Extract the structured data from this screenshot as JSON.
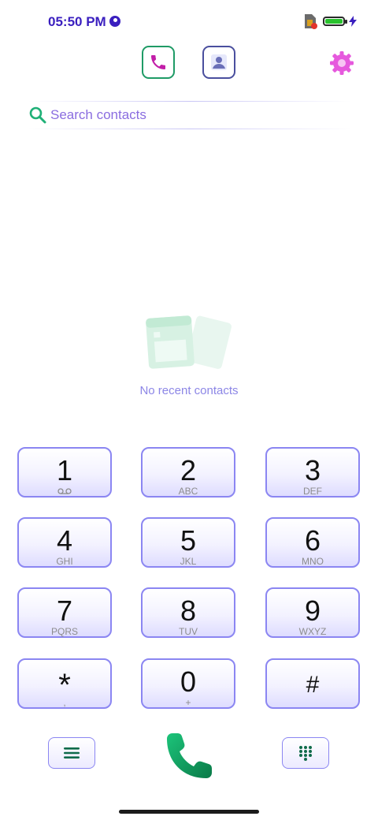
{
  "status_bar": {
    "time": "05:50 PM",
    "battery_level": 1.0,
    "battery_color": "#29c22d"
  },
  "tabs": [
    {
      "name": "phone",
      "icon": "phone-icon",
      "active": true,
      "color": "#1f9b66"
    },
    {
      "name": "contacts",
      "icon": "person-icon",
      "active": false,
      "color": "#4a4f9e"
    }
  ],
  "settings_icon": "gear-icon",
  "search": {
    "placeholder": "Search contacts",
    "value": ""
  },
  "empty_state": {
    "icon": "recent-contacts-illustration",
    "message": "No recent contacts"
  },
  "dialpad": {
    "keys": [
      {
        "digit": "1",
        "letters": "",
        "icon": "voicemail-icon"
      },
      {
        "digit": "2",
        "letters": "ABC"
      },
      {
        "digit": "3",
        "letters": "DEF"
      },
      {
        "digit": "4",
        "letters": "GHI"
      },
      {
        "digit": "5",
        "letters": "JKL"
      },
      {
        "digit": "6",
        "letters": "MNO"
      },
      {
        "digit": "7",
        "letters": "PQRS"
      },
      {
        "digit": "8",
        "letters": "TUV"
      },
      {
        "digit": "9",
        "letters": "WXYZ"
      },
      {
        "digit": "*",
        "letters": ","
      },
      {
        "digit": "0",
        "letters": "+"
      },
      {
        "digit": "#",
        "letters": ""
      }
    ]
  },
  "bottom_bar": {
    "menu_icon": "menu-icon",
    "call_icon": "call-icon",
    "dialpad_icon": "dialpad-icon"
  },
  "colors": {
    "accent_purple": "#3a1fbf",
    "key_border": "#8b86f2",
    "placeholder": "#8a6de0",
    "call_green": "#14a35f"
  }
}
